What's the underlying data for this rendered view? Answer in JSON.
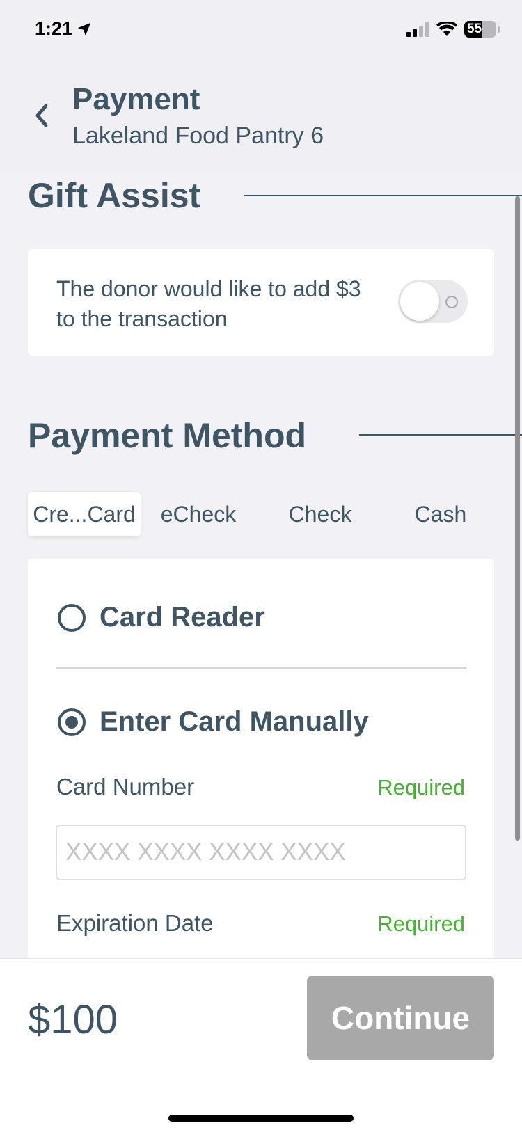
{
  "status_bar": {
    "time": "1:21",
    "battery": "55"
  },
  "header": {
    "title": "Payment",
    "subtitle": "Lakeland Food Pantry 6"
  },
  "gift_assist": {
    "section_title": "Gift Assist",
    "text": "The donor would like to add $3 to the transaction",
    "toggle_on": false
  },
  "payment_method": {
    "section_title": "Payment Method",
    "tabs": [
      {
        "label": "Cre...Card",
        "active": true
      },
      {
        "label": "eCheck",
        "active": false
      },
      {
        "label": "Check",
        "active": false
      },
      {
        "label": "Cash",
        "active": false
      }
    ],
    "options": [
      {
        "label": "Card Reader",
        "selected": false
      },
      {
        "label": "Enter Card Manually",
        "selected": true
      }
    ],
    "card_number": {
      "label": "Card Number",
      "required": "Required",
      "placeholder": "XXXX XXXX XXXX XXXX",
      "value": ""
    },
    "expiration": {
      "label": "Expiration Date",
      "required": "Required"
    }
  },
  "footer": {
    "amount": "$100",
    "continue_label": "Continue"
  },
  "colors": {
    "text": "#3F5564",
    "required": "#45B233",
    "disabled_button": "#A8A8A8",
    "background": "#F1F1F6"
  }
}
